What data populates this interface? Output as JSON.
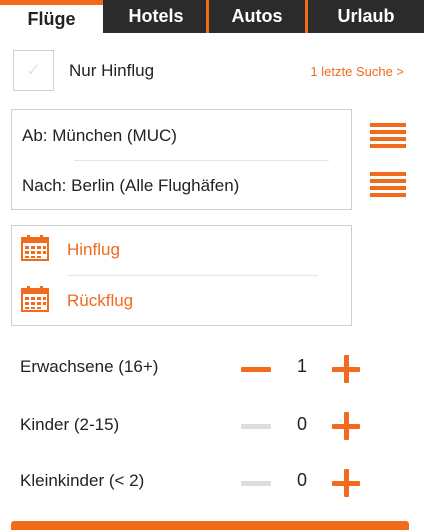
{
  "colors": {
    "accent": "#f26a1b",
    "tab_bar": "#2b2b2b",
    "disabled": "#dddddd"
  },
  "tabs": [
    {
      "label": "Flüge",
      "active": true
    },
    {
      "label": "Hotels",
      "active": false
    },
    {
      "label": "Autos",
      "active": false
    },
    {
      "label": "Urlaub",
      "active": false
    }
  ],
  "oneway": {
    "label": "Nur Hinflug",
    "checked": false,
    "icon": "check-icon"
  },
  "recent_search_link": "1 letzte Suche >",
  "route": {
    "from": "Ab:  München (MUC)",
    "to": "Nach:  Berlin (Alle Flughäfen)",
    "list_icon": "list-icon"
  },
  "dates": {
    "outbound": "Hinflug",
    "return": "Rückflug",
    "icon": "calendar-icon"
  },
  "passengers": [
    {
      "label": "Erwachsene (16+)",
      "count": "1",
      "minus_enabled": true
    },
    {
      "label": "Kinder (2-15)",
      "count": "0",
      "minus_enabled": false
    },
    {
      "label": "Kleinkinder (< 2)",
      "count": "0",
      "minus_enabled": false
    }
  ]
}
